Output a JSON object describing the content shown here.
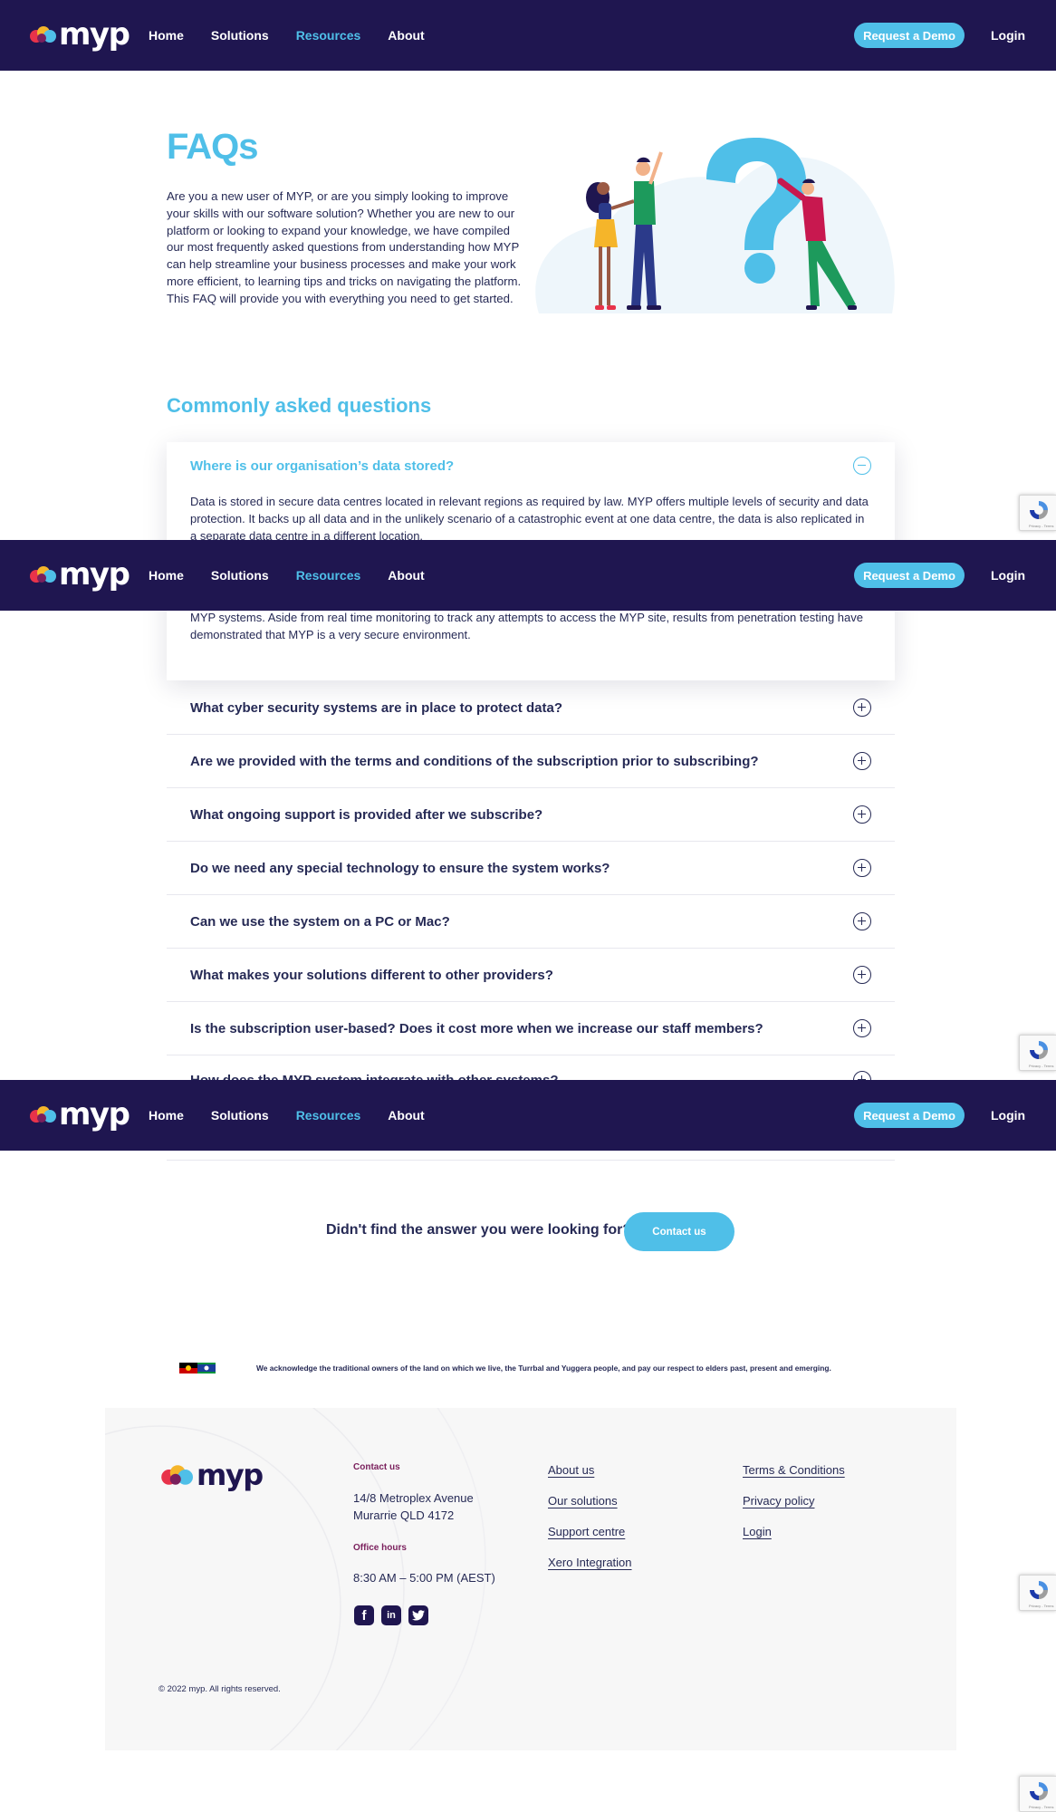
{
  "nav": {
    "logo_text": "myp",
    "links": [
      "Home",
      "Solutions",
      "Resources",
      "About"
    ],
    "active_link": "Resources",
    "demo_button": "Request a Demo",
    "login": "Login"
  },
  "hero": {
    "title": "FAQs",
    "intro": "Are you a new user of MYP, or are you simply looking to improve your skills with our software solution?  Whether you are new to our platform or looking to expand your knowledge, we have compiled our most frequently asked questions from understanding how MYP can help streamline your business processes and make your work more efficient, to learning tips and tricks on navigating the platform.  This FAQ will provide you with everything you need to get started."
  },
  "faq": {
    "heading": "Commonly asked questions",
    "open_item": {
      "question": "Where is our organisation’s data stored?",
      "answer_p1": "Data is stored in secure data centres located in relevant regions as required by law. MYP offers multiple levels of security and data protection. It backs up all data and in the unlikely scenario of a catastrophic event at one data centre, the data is also replicated in a separate data centre in a different location.",
      "answer_p2_partial": "MYP systems. Aside from real time monitoring to track any attempts to access the MYP site, results from penetration testing have demonstrated that MYP is a very secure environment."
    },
    "items": [
      "What cyber security systems are in place to protect data?",
      "Are we provided with the terms and conditions of the subscription prior to subscribing?",
      "What ongoing support is provided after we subscribe?",
      "Do we need any special technology to ensure the system works?",
      "Can we use the system on a PC or Mac?",
      "What makes your solutions different to other providers?",
      "Is the subscription user-based? Does it cost more when we increase our staff members?",
      "How does the MYP system integrate with other systems?"
    ]
  },
  "cta": {
    "text": "Didn't find the answer you were looking for?",
    "button": "Contact us"
  },
  "acknowledgement": "We acknowledge the traditional owners of the land on which we live, the Turrbal and Yuggera people, and pay our respect to elders past, present and emerging.",
  "footer": {
    "logo_text": "myp",
    "contact_label": "Contact us",
    "address_line1": "14/8 Metroplex Avenue",
    "address_line2": "Murarrie QLD 4172",
    "hours_label": "Office hours",
    "hours": "8:30 AM – 5:00 PM (AEST)",
    "social_icons": [
      "facebook-icon",
      "linkedin-icon",
      "twitter-icon"
    ],
    "links_col1": [
      "About us",
      "Our solutions",
      "Support centre",
      "Xero Integration"
    ],
    "links_col2": [
      "Terms & Conditions",
      "Privacy policy",
      "Login"
    ],
    "copyright": "© 2022 myp.  All rights reserved."
  },
  "recaptcha": {
    "text": "Privacy - Terms"
  },
  "colors": {
    "navy": "#1f1650",
    "accent_blue": "#4fbfe8",
    "text": "#262a55",
    "footer_bg": "#f7f7f7",
    "footer_label": "#7a1f5c"
  }
}
